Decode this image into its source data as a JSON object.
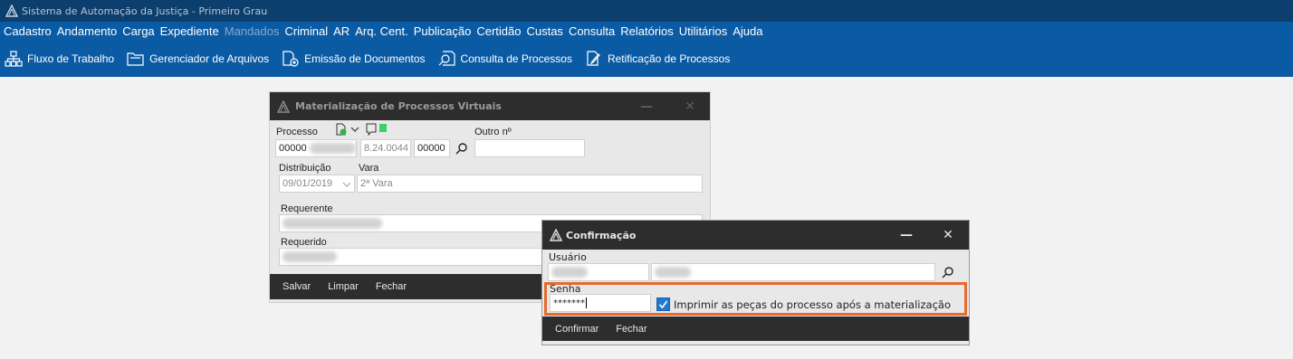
{
  "app": {
    "title": "Sistema de Automação da Justiça - Primeiro Grau"
  },
  "menu": [
    {
      "label": "Cadastro",
      "disabled": false
    },
    {
      "label": "Andamento",
      "disabled": false
    },
    {
      "label": "Carga",
      "disabled": false
    },
    {
      "label": "Expediente",
      "disabled": false
    },
    {
      "label": "Mandados",
      "disabled": true
    },
    {
      "label": "Criminal",
      "disabled": false
    },
    {
      "label": "AR",
      "disabled": false
    },
    {
      "label": "Arq. Cent.",
      "disabled": false
    },
    {
      "label": "Publicação",
      "disabled": false
    },
    {
      "label": "Certidão",
      "disabled": false
    },
    {
      "label": "Custas",
      "disabled": false
    },
    {
      "label": "Consulta",
      "disabled": false
    },
    {
      "label": "Relatórios",
      "disabled": false
    },
    {
      "label": "Utilitários",
      "disabled": false
    },
    {
      "label": "Ajuda",
      "disabled": false
    }
  ],
  "toolbar": [
    {
      "label": "Fluxo de Trabalho",
      "icon": "workflow-icon"
    },
    {
      "label": "Gerenciador de Arquivos",
      "icon": "folder-icon"
    },
    {
      "label": "Emissão de Documentos",
      "icon": "document-add-icon"
    },
    {
      "label": "Consulta de Processos",
      "icon": "search-document-icon"
    },
    {
      "label": "Retificação de Processos",
      "icon": "edit-document-icon"
    }
  ],
  "materializacao": {
    "title": "Materialização de Processos Virtuais",
    "processo_label": "Processo",
    "processo_part1": "00000",
    "processo_part2": "8.24.0044",
    "processo_part3": "00000",
    "outro_label": "Outro nº",
    "outro_value": "",
    "distribuicao_label": "Distribuição",
    "distribuicao_value": "09/01/2019",
    "vara_label": "Vara",
    "vara_value": "2ª Vara",
    "requerente_label": "Requerente",
    "requerido_label": "Requerido",
    "buttons": {
      "salvar": "Salvar",
      "limpar": "Limpar",
      "fechar": "Fechar"
    }
  },
  "confirmacao": {
    "title": "Confirmação",
    "usuario_label": "Usuário",
    "senha_label": "Senha",
    "senha_value": "*******",
    "imprimir_label": "Imprimir as peças do processo após a materialização",
    "imprimir_checked": true,
    "buttons": {
      "confirmar": "Confirmar",
      "fechar": "Fechar"
    }
  },
  "colors": {
    "titlebar": "#0d3f6e",
    "menubar": "#0b5ba4",
    "dialog_header": "#2d2d2d",
    "highlight": "#e8692f",
    "checkbox": "#2279d1",
    "status_green": "#3ccf6d"
  }
}
